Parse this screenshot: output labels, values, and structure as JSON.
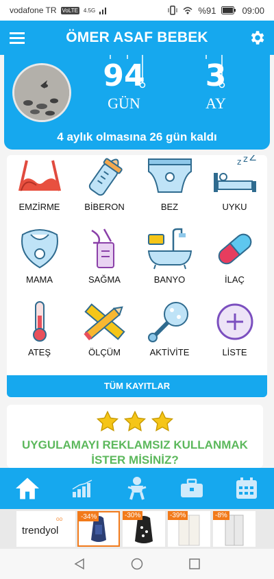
{
  "status_bar": {
    "carrier": "vodafone TR",
    "volte": "VoLTE",
    "network": "4.5G",
    "battery": "%91",
    "time": "09:00"
  },
  "header": {
    "title": "ÖMER ASAF BEBEK",
    "menu_icon": "hamburger-icon",
    "settings_icon": "gear-icon"
  },
  "age": {
    "days_value": "94",
    "days_unit": "GÜN",
    "months_value": "3",
    "months_unit": "AY",
    "message": "4 aylık olmasına 26 gün kaldı"
  },
  "categories": [
    {
      "label": "EMZİRME",
      "icon": "bra-icon"
    },
    {
      "label": "BİBERON",
      "icon": "baby-bottle-icon"
    },
    {
      "label": "BEZ",
      "icon": "diaper-icon"
    },
    {
      "label": "UYKU",
      "icon": "sleep-bed-icon"
    },
    {
      "label": "MAMA",
      "icon": "bib-icon"
    },
    {
      "label": "SAĞMA",
      "icon": "breast-pump-icon"
    },
    {
      "label": "BANYO",
      "icon": "bathtub-icon"
    },
    {
      "label": "İLAÇ",
      "icon": "pill-icon"
    },
    {
      "label": "ATEŞ",
      "icon": "thermometer-icon"
    },
    {
      "label": "ÖLÇÜM",
      "icon": "ruler-pencil-icon"
    },
    {
      "label": "AKTİVİTE",
      "icon": "rattle-icon"
    },
    {
      "label": "LİSTE",
      "icon": "plus-circle-icon"
    }
  ],
  "all_records_label": "TÜM KAYITLAR",
  "promo": {
    "line1": "UYGULAMAYI REKLAMSIZ KULLANMAK",
    "line2": "İSTER MİSİNİZ?",
    "stars_icon": "star-icon"
  },
  "bottom_nav": [
    {
      "icon": "home-icon"
    },
    {
      "icon": "bar-chart-icon"
    },
    {
      "icon": "baby-icon"
    },
    {
      "icon": "briefcase-icon"
    },
    {
      "icon": "calendar-icon"
    }
  ],
  "ad": {
    "brand": "trendyol",
    "brand_tag": "GO",
    "discounts": [
      "-34%",
      "-30%",
      "-39%",
      "-8%"
    ]
  },
  "colors": {
    "primary": "#16a8ee",
    "promo_green": "#5cb85c",
    "ad_orange": "#f27a1a"
  }
}
